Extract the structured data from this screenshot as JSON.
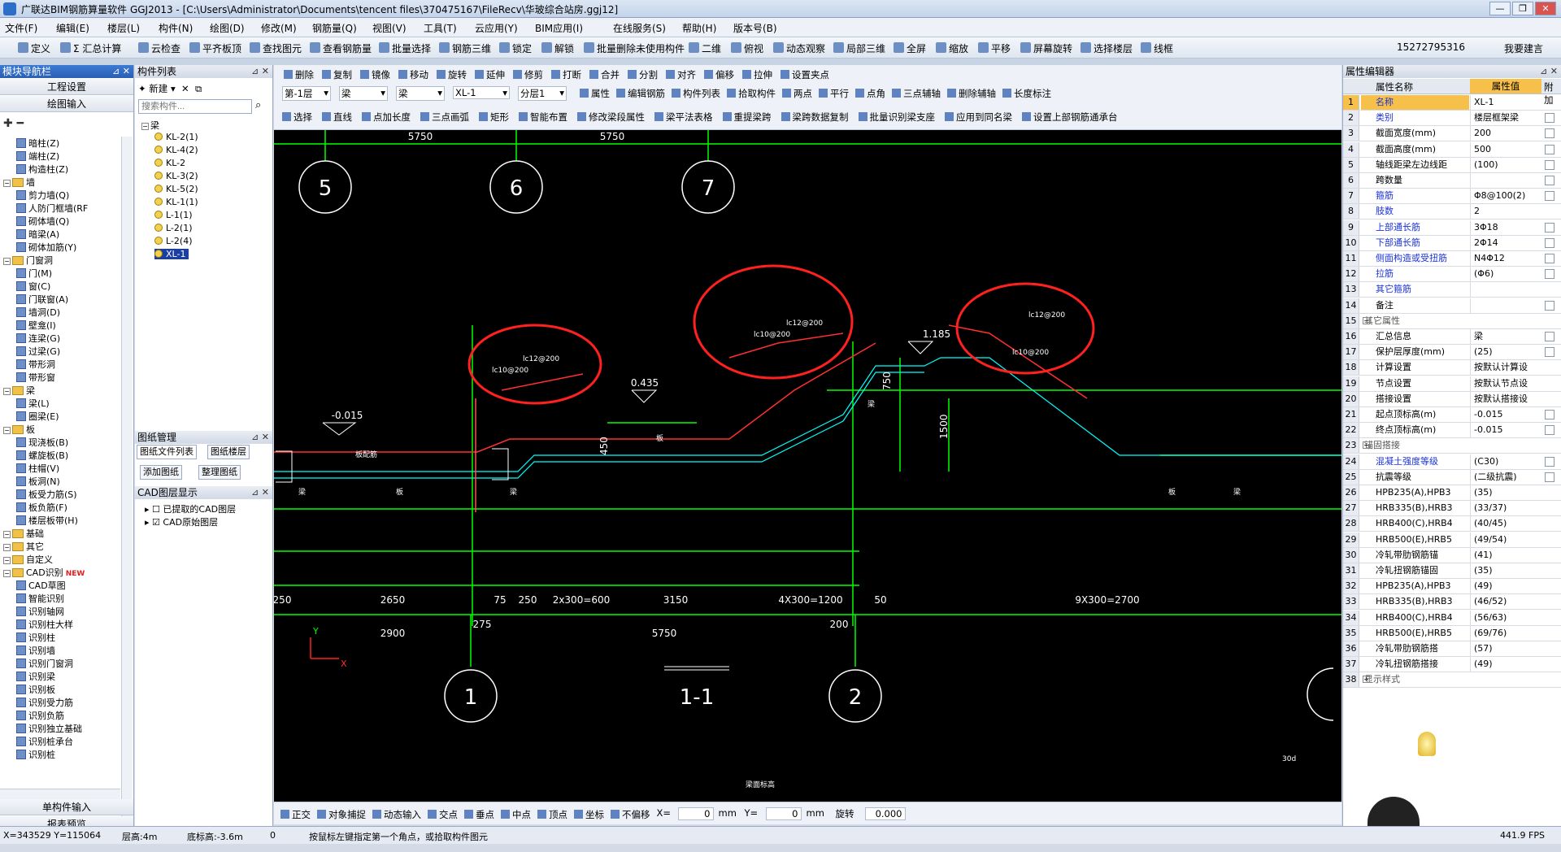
{
  "window": {
    "title": "广联达BIM钢筋算量软件 GGJ2013 - [C:\\Users\\Administrator\\Documents\\tencent files\\370475167\\FileRecv\\华玻综合站房.ggj12]"
  },
  "menu": [
    "文件(F)",
    "编辑(E)",
    "楼层(L)",
    "构件(N)",
    "绘图(D)",
    "修改(M)",
    "钢筋量(Q)",
    "视图(V)",
    "工具(T)",
    "云应用(Y)",
    "BIM应用(I)",
    "在线服务(S)",
    "帮助(H)",
    "版本号(B)"
  ],
  "toolbar": {
    "items": [
      "定义",
      "Σ 汇总计算",
      "云检查",
      "平齐板顶",
      "查找图元",
      "查看钢筋量",
      "批量选择",
      "钢筋三维",
      "锁定",
      "解锁",
      "批量删除未使用构件",
      "二维",
      "俯视",
      "动态观察",
      "局部三维",
      "全屏",
      "缩放",
      "平移",
      "屏幕旋转",
      "选择楼层",
      "线框"
    ],
    "phone": "15272795316",
    "help": "我要建言"
  },
  "left_nav": {
    "title": "模块导航栏",
    "buttons": [
      "工程设置",
      "绘图输入"
    ],
    "bottom": [
      "单构件输入",
      "报表预览"
    ],
    "tree": [
      {
        "label": "暗柱(Z)",
        "type": "item"
      },
      {
        "label": "端柱(Z)",
        "type": "item"
      },
      {
        "label": "构造柱(Z)",
        "type": "item"
      },
      {
        "label": "墙",
        "type": "folder"
      },
      {
        "label": "剪力墙(Q)",
        "type": "item"
      },
      {
        "label": "人防门框墙(RF",
        "type": "item"
      },
      {
        "label": "砌体墙(Q)",
        "type": "item"
      },
      {
        "label": "暗梁(A)",
        "type": "item"
      },
      {
        "label": "砌体加筋(Y)",
        "type": "item"
      },
      {
        "label": "门窗洞",
        "type": "folder"
      },
      {
        "label": "门(M)",
        "type": "item"
      },
      {
        "label": "窗(C)",
        "type": "item"
      },
      {
        "label": "门联窗(A)",
        "type": "item"
      },
      {
        "label": "墙洞(D)",
        "type": "item"
      },
      {
        "label": "壁龛(I)",
        "type": "item"
      },
      {
        "label": "连梁(G)",
        "type": "item"
      },
      {
        "label": "过梁(G)",
        "type": "item"
      },
      {
        "label": "带形洞",
        "type": "item"
      },
      {
        "label": "带形窗",
        "type": "item"
      },
      {
        "label": "梁",
        "type": "folder"
      },
      {
        "label": "梁(L)",
        "type": "item"
      },
      {
        "label": "圈梁(E)",
        "type": "item"
      },
      {
        "label": "板",
        "type": "folder"
      },
      {
        "label": "现浇板(B)",
        "type": "item"
      },
      {
        "label": "螺旋板(B)",
        "type": "item"
      },
      {
        "label": "柱帽(V)",
        "type": "item"
      },
      {
        "label": "板洞(N)",
        "type": "item"
      },
      {
        "label": "板受力筋(S)",
        "type": "item"
      },
      {
        "label": "板负筋(F)",
        "type": "item"
      },
      {
        "label": "楼层板带(H)",
        "type": "item"
      },
      {
        "label": "基础",
        "type": "folder"
      },
      {
        "label": "其它",
        "type": "folder"
      },
      {
        "label": "自定义",
        "type": "folder"
      },
      {
        "label": "CAD识别",
        "type": "folder",
        "badge": "NEW"
      },
      {
        "label": "CAD草图",
        "type": "item"
      },
      {
        "label": "智能识别",
        "type": "item"
      },
      {
        "label": "识别轴网",
        "type": "item"
      },
      {
        "label": "识别柱大样",
        "type": "item"
      },
      {
        "label": "识别柱",
        "type": "item"
      },
      {
        "label": "识别墙",
        "type": "item"
      },
      {
        "label": "识别门窗洞",
        "type": "item"
      },
      {
        "label": "识别梁",
        "type": "item"
      },
      {
        "label": "识别板",
        "type": "item"
      },
      {
        "label": "识别受力筋",
        "type": "item"
      },
      {
        "label": "识别负筋",
        "type": "item"
      },
      {
        "label": "识别独立基础",
        "type": "item"
      },
      {
        "label": "识别桩承台",
        "type": "item"
      },
      {
        "label": "识别桩",
        "type": "item"
      }
    ]
  },
  "component_list": {
    "title": "构件列表",
    "new_label": "新建",
    "search_placeholder": "搜索构件...",
    "root": "梁",
    "items": [
      "KL-2(1)",
      "KL-4(2)",
      "KL-2",
      "KL-3(2)",
      "KL-5(2)",
      "KL-1(1)",
      "L-1(1)",
      "L-2(1)",
      "L-2(4)",
      "XL-1"
    ],
    "selected": "XL-1"
  },
  "drawing_mgmt": {
    "title": "图纸管理",
    "tabs": [
      "图纸文件列表",
      "图纸楼层"
    ],
    "buttons": [
      "添加图纸",
      "整理图纸"
    ],
    "layer_title": "CAD图层显示",
    "layers": [
      {
        "label": "已提取的CAD图层",
        "checked": false
      },
      {
        "label": "CAD原始图层",
        "checked": true
      }
    ]
  },
  "draw_toolbar": {
    "row1": [
      "删除",
      "复制",
      "镜像",
      "移动",
      "旋转",
      "延伸",
      "修剪",
      "打断",
      "合并",
      "分割",
      "对齐",
      "偏移",
      "拉伸",
      "设置夹点"
    ],
    "row2": {
      "floor": "第-1层",
      "type": "梁",
      "sub": "梁",
      "comp": "XL-1",
      "layer": "分层1",
      "items": [
        "属性",
        "编辑钢筋",
        "构件列表",
        "拾取构件",
        "两点",
        "平行",
        "点角",
        "三点辅轴",
        "删除辅轴",
        "长度标注"
      ]
    },
    "row3": [
      "选择",
      "直线",
      "点加长度",
      "三点画弧",
      "矩形",
      "智能布置",
      "修改梁段属性",
      "梁平法表格",
      "重提梁跨",
      "梁跨数据复制",
      "批量识别梁支座",
      "应用到同名梁",
      "设置上部钢筋通承台"
    ]
  },
  "cad": {
    "axes_top": [
      "5",
      "6",
      "7"
    ],
    "dims_top": [
      "5750",
      "5750"
    ],
    "axes_bottom": [
      "1",
      "2"
    ],
    "section": "1-1",
    "elevations": [
      "-0.015",
      "0.435",
      "1.185"
    ],
    "dims_row": [
      "250",
      "2650",
      "75",
      "250",
      "2x300=600",
      "3150",
      "4X300=1200",
      "50",
      "9X300=2700"
    ],
    "dims_row2": [
      "2900",
      "275",
      "5750",
      "200"
    ],
    "vertical_dims": [
      "450",
      "750",
      "1500"
    ],
    "rebar_labels": [
      [
        "lc12@200",
        "lc10@200"
      ],
      [
        "lc12@200",
        "lc10@200"
      ],
      [
        "lc12@200",
        "lc10@200"
      ]
    ],
    "misc": [
      "板配筋",
      "板",
      "梁",
      "板",
      "梁",
      "梁",
      "板",
      "梁",
      "梁面标高",
      "30d"
    ]
  },
  "snap_bar": {
    "items": [
      "正交",
      "对象捕捉",
      "动态输入",
      "交点",
      "垂点",
      "中点",
      "顶点",
      "坐标",
      "不偏移"
    ],
    "x_label": "X=",
    "x": "0",
    "y_label": "Y=",
    "y": "0",
    "unit": "mm",
    "rotate_label": "旋转",
    "rotate": "0.000"
  },
  "status": {
    "coords": "X=343529 Y=115064",
    "floor_height": "层高:4m",
    "bottom_elev": "底标高:-3.6m",
    "zero": "0",
    "hint": "按鼠标左键指定第一个角点，或拾取构件图元",
    "fps": "441.9 FPS"
  },
  "properties": {
    "title": "属性编辑器",
    "headers": [
      "属性名称",
      "属性值",
      "附加"
    ],
    "rows": [
      {
        "n": "1",
        "k": "名称",
        "v": "XL-1",
        "blue": true,
        "check": false
      },
      {
        "n": "2",
        "k": "类别",
        "v": "楼层框架梁",
        "blue": true,
        "check": true
      },
      {
        "n": "3",
        "k": "截面宽度(mm)",
        "v": "200",
        "check": true
      },
      {
        "n": "4",
        "k": "截面高度(mm)",
        "v": "500",
        "check": true
      },
      {
        "n": "5",
        "k": "轴线距梁左边线距",
        "v": "(100)",
        "check": true
      },
      {
        "n": "6",
        "k": "跨数量",
        "v": "",
        "check": true
      },
      {
        "n": "7",
        "k": "箍筋",
        "v": "Φ8@100(2)",
        "blue": true,
        "check": true
      },
      {
        "n": "8",
        "k": "肢数",
        "v": "2",
        "blue": true,
        "check": false
      },
      {
        "n": "9",
        "k": "上部通长筋",
        "v": "3Φ18",
        "blue": true,
        "check": true
      },
      {
        "n": "10",
        "k": "下部通长筋",
        "v": "2Φ14",
        "blue": true,
        "check": true
      },
      {
        "n": "11",
        "k": "侧面构造或受扭筋",
        "v": "N4Φ12",
        "blue": true,
        "check": true
      },
      {
        "n": "12",
        "k": "拉筋",
        "v": "(Φ6)",
        "blue": true,
        "check": true
      },
      {
        "n": "13",
        "k": "其它箍筋",
        "v": "",
        "blue": true,
        "check": false
      },
      {
        "n": "14",
        "k": "备注",
        "v": "",
        "check": true
      },
      {
        "n": "15",
        "k": "其它属性",
        "v": "",
        "group": true
      },
      {
        "n": "16",
        "k": "汇总信息",
        "v": "梁",
        "check": true
      },
      {
        "n": "17",
        "k": "保护层厚度(mm)",
        "v": "(25)",
        "check": true
      },
      {
        "n": "18",
        "k": "计算设置",
        "v": "按默认计算设",
        "check": false
      },
      {
        "n": "19",
        "k": "节点设置",
        "v": "按默认节点设",
        "check": false
      },
      {
        "n": "20",
        "k": "搭接设置",
        "v": "按默认搭接设",
        "check": false
      },
      {
        "n": "21",
        "k": "起点顶标高(m)",
        "v": "-0.015",
        "check": true
      },
      {
        "n": "22",
        "k": "终点顶标高(m)",
        "v": "-0.015",
        "check": true
      },
      {
        "n": "23",
        "k": "锚固搭接",
        "v": "",
        "group": true
      },
      {
        "n": "24",
        "k": "混凝土强度等级",
        "v": "(C30)",
        "blue": true,
        "check": true
      },
      {
        "n": "25",
        "k": "抗震等级",
        "v": "(二级抗震)",
        "check": true
      },
      {
        "n": "26",
        "k": "HPB235(A),HPB3",
        "v": "(35)",
        "check": false
      },
      {
        "n": "27",
        "k": "HRB335(B),HRB3",
        "v": "(33/37)",
        "check": false
      },
      {
        "n": "28",
        "k": "HRB400(C),HRB4",
        "v": "(40/45)",
        "check": false
      },
      {
        "n": "29",
        "k": "HRB500(E),HRB5",
        "v": "(49/54)",
        "check": false
      },
      {
        "n": "30",
        "k": "冷轧带肋钢筋锚",
        "v": "(41)",
        "check": false
      },
      {
        "n": "31",
        "k": "冷轧扭钢筋锚固",
        "v": "(35)",
        "check": false
      },
      {
        "n": "32",
        "k": "HPB235(A),HPB3",
        "v": "(49)",
        "check": false
      },
      {
        "n": "33",
        "k": "HRB335(B),HRB3",
        "v": "(46/52)",
        "check": false
      },
      {
        "n": "34",
        "k": "HRB400(C),HRB4",
        "v": "(56/63)",
        "check": false
      },
      {
        "n": "35",
        "k": "HRB500(E),HRB5",
        "v": "(69/76)",
        "check": false
      },
      {
        "n": "36",
        "k": "冷轧带肋钢筋搭",
        "v": "(57)",
        "check": false
      },
      {
        "n": "37",
        "k": "冷轧扭钢筋搭接",
        "v": "(49)",
        "check": false
      },
      {
        "n": "38",
        "k": "显示样式",
        "v": "",
        "group": true
      }
    ]
  }
}
